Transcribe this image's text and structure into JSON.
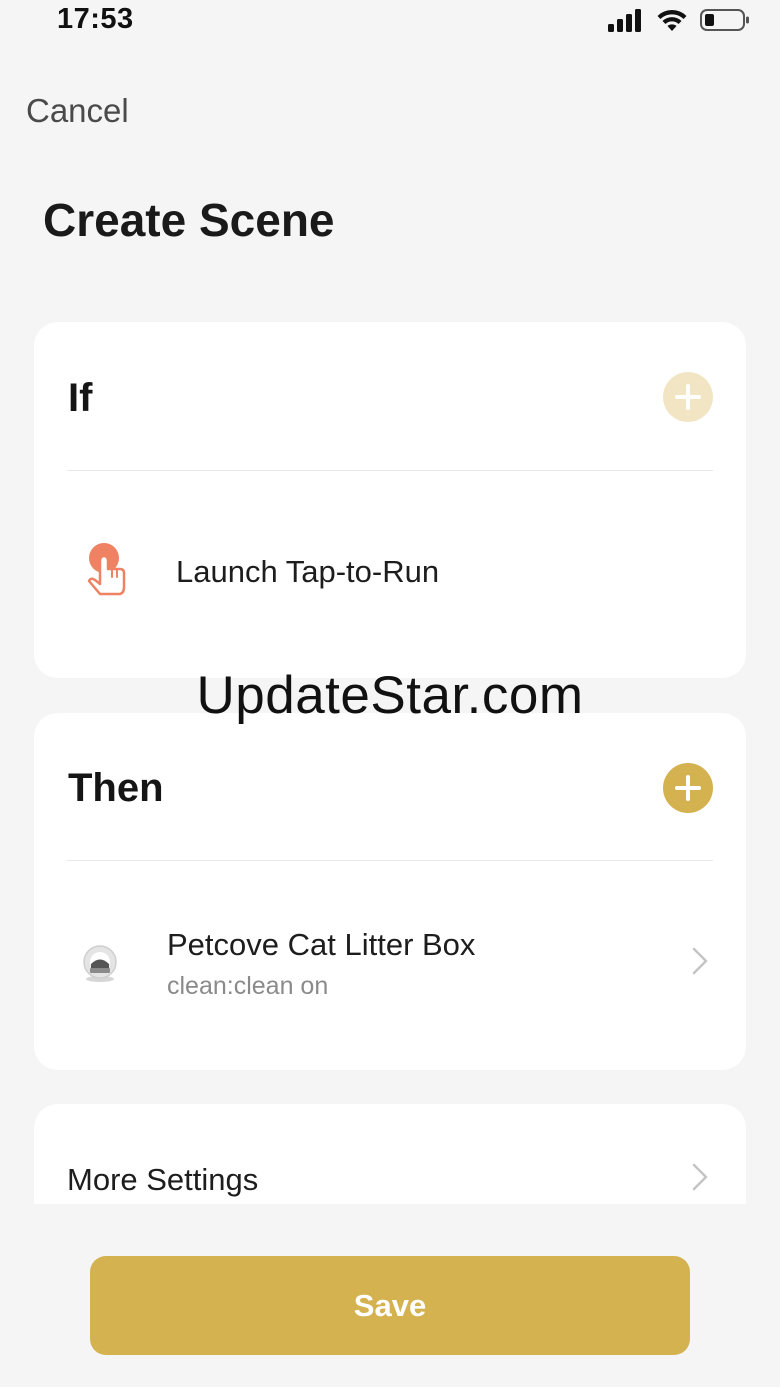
{
  "status_bar": {
    "time": "17:53",
    "icons": [
      "cellular-signal-icon",
      "wifi-icon",
      "battery-icon"
    ]
  },
  "nav": {
    "cancel_label": "Cancel"
  },
  "page": {
    "title": "Create Scene"
  },
  "if_card": {
    "title": "If",
    "add_icon": "plus-icon",
    "condition": {
      "icon": "tap-hand-icon",
      "label": "Launch Tap-to-Run"
    }
  },
  "then_card": {
    "title": "Then",
    "add_icon": "plus-icon",
    "action": {
      "icon": "litter-box-device-icon",
      "label": "Petcove Cat Litter Box",
      "detail": "clean:clean on",
      "chevron_icon": "chevron-right-icon"
    }
  },
  "more_settings": {
    "label": "More Settings",
    "chevron_icon": "chevron-right-icon"
  },
  "watermark": "UpdateStar.com",
  "save_label": "Save",
  "colors": {
    "accent": "#d4b250",
    "accent_disabled": "#f1e5c3",
    "tap_icon": "#ee8263",
    "background": "#f5f5f5",
    "card": "#ffffff"
  }
}
